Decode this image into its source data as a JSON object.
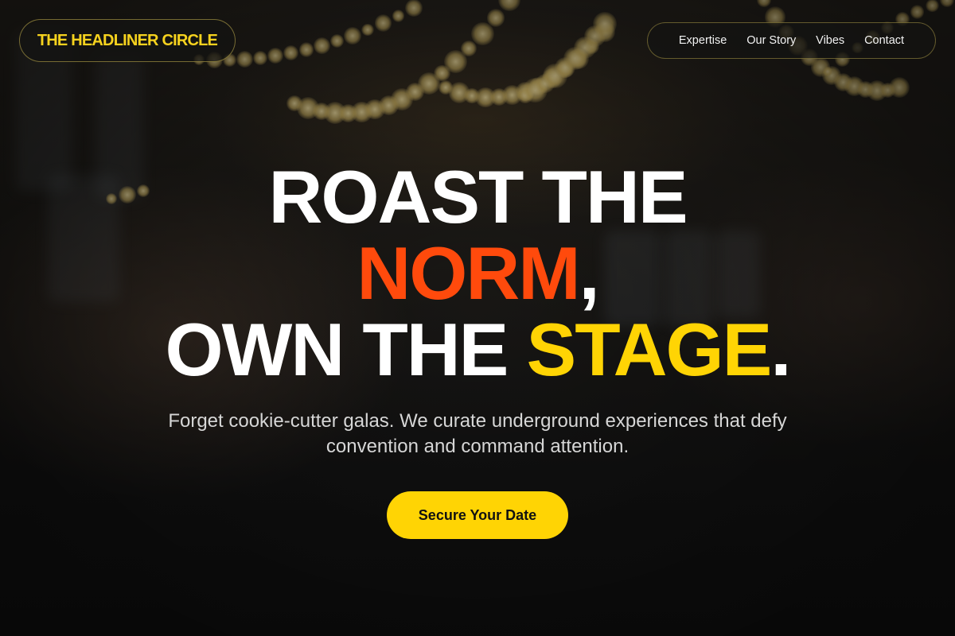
{
  "brand": {
    "name": "THE HEADLINER CIRCLE"
  },
  "nav": {
    "items": [
      {
        "label": "Expertise"
      },
      {
        "label": "Our Story"
      },
      {
        "label": "Vibes"
      },
      {
        "label": "Contact"
      }
    ]
  },
  "hero": {
    "line1": "ROAST THE",
    "line2_highlight": "NORM",
    "line2_suffix": ",",
    "line3_prefix": "OWN THE ",
    "line3_highlight": "STAGE",
    "line3_suffix": ".",
    "subtitle": "Forget cookie-cutter galas. We curate underground experiences that defy convention and command attention.",
    "cta_label": "Secure Your Date"
  },
  "colors": {
    "accent_yellow": "#ffd404",
    "accent_orange": "#ff4a0c",
    "background": "#141414"
  },
  "background_image": {
    "icon": "party-string-lights-photo"
  }
}
